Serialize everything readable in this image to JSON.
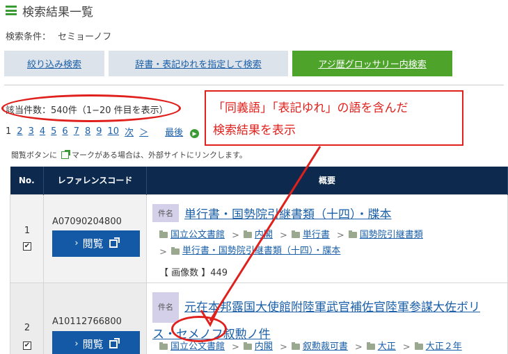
{
  "header": {
    "title": "検索結果一覧"
  },
  "condition": {
    "label": "検索条件：",
    "value": "セミョーノフ"
  },
  "tabs": [
    {
      "label": "絞り込み検索"
    },
    {
      "label": "辞書・表記ゆれを指定して検索"
    },
    {
      "label": "アジ歴グロッサリー内検索"
    }
  ],
  "result_count": "該当件数：540件（1−20 件目を表示）",
  "pager": {
    "current": "1",
    "pages": [
      "2",
      "3",
      "4",
      "5",
      "6",
      "7",
      "8",
      "9",
      "10"
    ],
    "next": "次",
    "next_arrow": "＞",
    "last": "最後"
  },
  "note": {
    "before": "閲覧ボタンに",
    "after": "マークがある場合は、外部サイトにリンクします。"
  },
  "table": {
    "headers": {
      "no": "No.",
      "code": "レファレンスコード",
      "summary": "概要"
    },
    "rows": [
      {
        "no": "1",
        "checked": "✔",
        "code": "A07090204800",
        "view": "閲覧",
        "tag": "件名",
        "title": "単行書・国勢院引継書類（十四）・牒本",
        "crumbs": [
          "国立公文書館",
          "内閣",
          "単行書",
          "国勢院引継書類",
          "単行書・国勢院引継書類（十四）・牒本"
        ],
        "image_count": "【 画像数 】449"
      },
      {
        "no": "2",
        "checked": "✔",
        "code": "A10112766800",
        "view": "閲覧",
        "tag": "件名",
        "title_line1": "元在本邦露国大使館附陸軍武官補佐官陸軍参謀大佐ボリ",
        "title_line2": "ス・セメノフ叙勲ノ件",
        "crumbs": [
          "国立公文書館",
          "内閣",
          "叙勲裁可書",
          "大正",
          "大正２年"
        ]
      }
    ]
  },
  "annotation": {
    "line1": "「同義語」「表記ゆれ」の語を含んだ",
    "line2": "検索結果を表示",
    "color": "#e0201c"
  },
  "colors": {
    "accent_green": "#4ea32b",
    "navy": "#0d2a4e",
    "button_blue": "#1459a6",
    "link": "#1a5fa8"
  }
}
